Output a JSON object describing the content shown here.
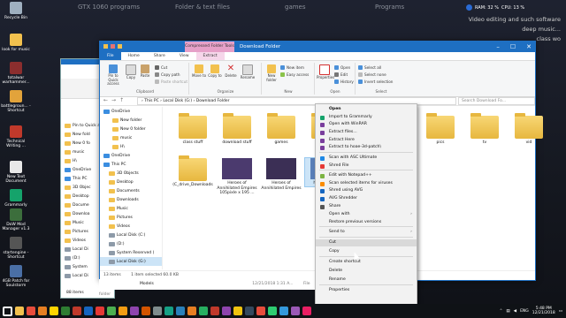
{
  "desktop": {
    "bg_texts": [
      "GTX 1060 programs",
      "Folder & text files",
      "games",
      "Programs"
    ],
    "right_texts": [
      "Video editing and such software",
      "deep music...",
      "class wo"
    ],
    "icons": [
      {
        "label": "Recycle Bin",
        "color": "#9fb0c0"
      },
      {
        "label": "look for music",
        "color": "#f2c14e"
      },
      {
        "label": "totalwar warhammer...",
        "color": "#8b2e2e"
      },
      {
        "label": "battlegroun... - Shortcut",
        "color": "#e2a33b"
      },
      {
        "label": "Technical Writing ...",
        "color": "#c0392b"
      },
      {
        "label": "New Text Document",
        "color": "#e8e8e8"
      },
      {
        "label": "Grammarly",
        "color": "#15a36b"
      },
      {
        "label": "DoW Mod Manager v1.3",
        "color": "#3c6e3c"
      },
      {
        "label": "startengine - Shortcut",
        "color": "#555555"
      },
      {
        "label": "4GB Patch for Soulstorm",
        "color": "#4a6fa5"
      }
    ]
  },
  "sysinfo": {
    "ram": "RAM: 32 %",
    "cpu": "CPU: 13 %"
  },
  "back_window": {
    "items": [
      "Pin to Quick access",
      "New fold",
      "New 0 fo",
      "music",
      "H\\",
      "OneDrive",
      "This PC",
      "3D Objec",
      "Desktop",
      "Docume",
      "Downloa",
      "Music",
      "Pictures",
      "Videos",
      "Local Di",
      "(D:)",
      "System",
      "Local Di"
    ],
    "count": "88 items"
  },
  "window": {
    "context_tab": "Compressed Folder Tools",
    "title": "Download Folder",
    "tabs": [
      "File",
      "Home",
      "Share",
      "View",
      "Extract"
    ],
    "ribbon": {
      "clipboard_label": "Clipboard",
      "organize_label": "Organize",
      "new_label": "New",
      "open_label": "Open",
      "select_label": "Select",
      "pin": "Pin to Quick access",
      "copy": "Copy",
      "paste": "Paste",
      "cut": "Cut",
      "copy_path": "Copy path",
      "paste_shortcut": "Paste shortcut",
      "move_to": "Move to",
      "copy_to": "Copy to",
      "delete": "Delete",
      "rename": "Rename",
      "new_folder": "New folder",
      "new_item": "New item",
      "easy_access": "Easy access",
      "properties": "Properties",
      "open": "Open",
      "edit": "Edit",
      "history": "History",
      "select_all": "Select all",
      "select_none": "Select none",
      "invert_selection": "Invert selection"
    },
    "address": "›  This PC  ›  Local Disk (G:)  ›  Download Folder",
    "search_placeholder": "Search Download Fo...",
    "sidebar": [
      "OneDrive",
      "New folder",
      "New 0 folder",
      "music",
      "H\\",
      "OneDrive",
      "This PC",
      "3D Objects",
      "Desktop",
      "Documents",
      "Downloads",
      "Music",
      "Pictures",
      "Videos",
      "Local Disk (C:)",
      "(D:)",
      "System Reserved (",
      "Local Disk (G:)"
    ],
    "files_row1": [
      "class stuff",
      "download stuff",
      "games",
      "ma",
      "pics",
      "tv",
      "vid"
    ],
    "files_row2": [
      "(C_drive_Downloads",
      "Heroes of Annihilated Empires 105pixle x 195 ...",
      "Heroes of Annihilated Empires",
      "hoae-3d-p..."
    ],
    "status": {
      "count": "13 items",
      "selected": "1 item selected  60.0 KB"
    }
  },
  "context_menu": {
    "items": [
      {
        "label": "Open",
        "icon": "none",
        "color": "#00000000"
      },
      {
        "label": "Import to Grammarly",
        "icon": "grammarly-icon",
        "color": "#15a36b"
      },
      {
        "label": "Open with WinRAR",
        "icon": "winrar-icon",
        "color": "#7a3e9d"
      },
      {
        "label": "Extract files...",
        "icon": "winrar-icon",
        "color": "#7a3e9d"
      },
      {
        "label": "Extract Here",
        "icon": "winrar-icon",
        "color": "#7a3e9d"
      },
      {
        "label": "Extract to hoae-3d-patch\\",
        "icon": "winrar-icon",
        "color": "#7a3e9d"
      },
      {
        "label": "Scan with ASC Ultimate",
        "icon": "asc-icon",
        "color": "#1e88e5"
      },
      {
        "label": "Shred File",
        "icon": "shred-icon",
        "color": "#e53935"
      },
      {
        "label": "Edit with Notepad++",
        "icon": "notepad-icon",
        "color": "#7cb342"
      },
      {
        "label": "Scan selected items for viruses",
        "icon": "shield-icon",
        "color": "#fb8c00"
      },
      {
        "label": "Shred using AVG",
        "icon": "avg-icon",
        "color": "#1565c0"
      },
      {
        "label": "AVG Shredder",
        "icon": "avg-icon",
        "color": "#1565c0"
      },
      {
        "label": "Share",
        "icon": "share-icon",
        "color": "#555555"
      },
      {
        "label": "Open with",
        "icon": "none",
        "color": "#00000000",
        "arrow": true
      },
      {
        "label": "Restore previous versions",
        "icon": "none",
        "color": "#00000000"
      },
      {
        "label": "Send to",
        "icon": "none",
        "color": "#00000000",
        "arrow": true
      },
      {
        "label": "Cut",
        "icon": "none",
        "color": "#00000000",
        "highlight": true
      },
      {
        "label": "Copy",
        "icon": "none",
        "color": "#00000000"
      },
      {
        "label": "Create shortcut",
        "icon": "none",
        "color": "#00000000"
      },
      {
        "label": "Delete",
        "icon": "none",
        "color": "#00000000"
      },
      {
        "label": "Rename",
        "icon": "none",
        "color": "#00000000"
      },
      {
        "label": "Properties",
        "icon": "none",
        "color": "#00000000"
      }
    ]
  },
  "under_window": {
    "name": "Models",
    "date": "12/21/2018 1:31 A...",
    "type": "File folder"
  },
  "taskbar": {
    "icons": [
      "#ffffff",
      "#f2c14e",
      "#e74c3c",
      "#e67e22",
      "#ffd400",
      "#2e7d32",
      "#c0392b",
      "#1565c0",
      "#e53935",
      "#4caf50",
      "#f39c12",
      "#8e44ad",
      "#d35400",
      "#7f8c8d",
      "#16a085",
      "#2980b9",
      "#e67e22",
      "#27ae60",
      "#c0392b",
      "#8e44ad",
      "#f1c40f",
      "#34495e",
      "#e74c3c",
      "#2ecc71",
      "#3498db",
      "#9b59b6",
      "#e91e63"
    ],
    "lang": "ENG",
    "time": "5:48 PM",
    "date": "12/21/2018"
  }
}
